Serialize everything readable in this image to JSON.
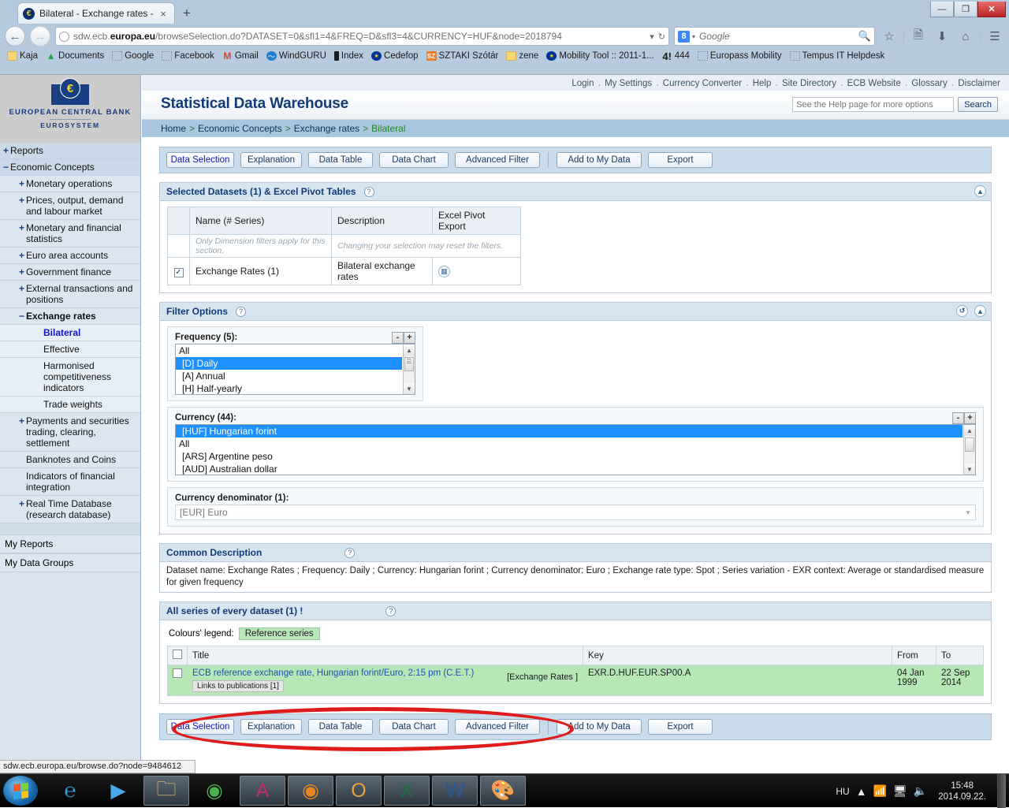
{
  "browser": {
    "tab_title": "Bilateral - Exchange rates - ...",
    "tab_favicon": "euro-icon",
    "new_tab_label": "+",
    "close_tab_label": "×",
    "url_prefix": "sdw.ecb.",
    "url_domain": "europa.eu",
    "url_path": "/browseSelection.do?DATASET=0&sfl1=4&FREQ=D&sfl3=4&CURRENCY=HUF&node=2018794",
    "search_engine": "Google",
    "search_placeholder": "Google",
    "window_minimize": "—",
    "window_restore": "❐",
    "window_close": "✕",
    "bookmarks": [
      {
        "label": "Kaja",
        "icon": "folder-icon"
      },
      {
        "label": "Documents",
        "icon": "drive-icon"
      },
      {
        "label": "Google",
        "icon": "dotted-icon"
      },
      {
        "label": "Facebook",
        "icon": "dotted-icon"
      },
      {
        "label": "Gmail",
        "icon": "gmail-icon"
      },
      {
        "label": "WindGURU",
        "icon": "wind-icon"
      },
      {
        "label": "Index",
        "icon": "index-icon"
      },
      {
        "label": "Cedefop",
        "icon": "eu-icon"
      },
      {
        "label": "SZTAKI Szótár",
        "icon": "sztaki-icon"
      },
      {
        "label": "zene",
        "icon": "folder-icon"
      },
      {
        "label": "Mobility Tool :: 2011-1...",
        "icon": "eu-icon"
      },
      {
        "label": "444",
        "icon": "444-icon"
      },
      {
        "label": "Europass Mobility",
        "icon": "dotted-icon"
      },
      {
        "label": "Tempus IT Helpdesk",
        "icon": "dotted-icon"
      }
    ]
  },
  "sidebar": {
    "logo": {
      "symbol": "€",
      "line1": "EUROPEAN CENTRAL BANK",
      "line2": "EUROSYSTEM"
    },
    "tree": [
      {
        "label": "Reports",
        "level": 0,
        "toggle": "+",
        "selected": false
      },
      {
        "label": "Economic Concepts",
        "level": 0,
        "toggle": "−",
        "selected": false
      },
      {
        "label": "Monetary operations",
        "level": 1,
        "toggle": "+",
        "selected": false
      },
      {
        "label": "Prices, output, demand and labour market",
        "level": 1,
        "toggle": "+",
        "selected": false
      },
      {
        "label": "Monetary and financial statistics",
        "level": 1,
        "toggle": "+",
        "selected": false
      },
      {
        "label": "Euro area accounts",
        "level": 1,
        "toggle": "+",
        "selected": false
      },
      {
        "label": "Government finance",
        "level": 1,
        "toggle": "+",
        "selected": false
      },
      {
        "label": "External transactions and positions",
        "level": 1,
        "toggle": "+",
        "selected": false
      },
      {
        "label": "Exchange rates",
        "level": 1,
        "toggle": "−",
        "selected": false,
        "open": true
      },
      {
        "label": "Bilateral",
        "level": 2,
        "toggle": "",
        "selected": true
      },
      {
        "label": "Effective",
        "level": 2,
        "toggle": "",
        "selected": false
      },
      {
        "label": "Harmonised competitiveness indicators",
        "level": 2,
        "toggle": "",
        "selected": false
      },
      {
        "label": "Trade weights",
        "level": 2,
        "toggle": "",
        "selected": false
      },
      {
        "label": "Payments and securities trading, clearing, settlement",
        "level": 1,
        "toggle": "+",
        "selected": false
      },
      {
        "label": "Banknotes and Coins",
        "level": 1,
        "toggle": "",
        "selected": false
      },
      {
        "label": "Indicators of financial integration",
        "level": 1,
        "toggle": "",
        "selected": false
      },
      {
        "label": "Real Time Database (research database)",
        "level": 1,
        "toggle": "+",
        "selected": false
      }
    ],
    "footer_items": [
      {
        "label": "My Reports"
      },
      {
        "label": "My Data Groups"
      }
    ]
  },
  "header": {
    "top_links": [
      "Login",
      "My Settings",
      "Currency Converter",
      "Help",
      "Site Directory",
      "ECB Website",
      "Glossary",
      "Disclaimer"
    ],
    "title": "Statistical Data Warehouse",
    "search_placeholder": "See the Help page for more options",
    "search_button": "Search",
    "breadcrumb": [
      "Home",
      "Economic Concepts",
      "Exchange rates",
      "Bilateral"
    ]
  },
  "toolbar": {
    "buttons": [
      {
        "label": "Data Selection",
        "active": true
      },
      {
        "label": "Explanation",
        "active": false
      },
      {
        "label": "Data Table",
        "active": false
      },
      {
        "label": "Data Chart",
        "active": false
      },
      {
        "label": "Advanced Filter",
        "active": false
      },
      {
        "label": "Add to My Data",
        "active": false
      },
      {
        "label": "Export",
        "active": false
      }
    ]
  },
  "datasets_panel": {
    "title": "Selected Datasets (1) & Excel Pivot Tables",
    "help": "?",
    "collapse_icon": "chevron-up-icon",
    "columns": [
      "Name (# Series)",
      "Description",
      "Excel Pivot Export"
    ],
    "notes": [
      "Only Dimension filters apply for this section.",
      "Changing your selection may reset the filters."
    ],
    "rows": [
      {
        "checked": true,
        "name": "Exchange Rates   (1)",
        "description": "Bilateral exchange rates",
        "pivot_icon": "grid-icon"
      }
    ]
  },
  "filter_panel": {
    "title": "Filter Options",
    "help": "?",
    "reset_icon": "reset-icon",
    "collapse_icon": "chevron-up-icon",
    "frequency": {
      "label": "Frequency (5):",
      "minus": "-",
      "plus": "+",
      "options": [
        {
          "label": "All",
          "selected": false,
          "indent": false
        },
        {
          "label": "[D] Daily",
          "selected": true,
          "indent": true
        },
        {
          "label": "[A] Annual",
          "selected": false,
          "indent": true
        },
        {
          "label": "[H] Half-yearly",
          "selected": false,
          "indent": true
        }
      ]
    },
    "currency": {
      "label": "Currency  (44):",
      "minus": "-",
      "plus": "+",
      "options": [
        {
          "label": "[HUF] Hungarian forint",
          "selected": true,
          "indent": true
        },
        {
          "label": "All",
          "selected": false,
          "indent": false
        },
        {
          "label": "[ARS] Argentine peso",
          "selected": false,
          "indent": true
        },
        {
          "label": "[AUD] Australian dollar",
          "selected": false,
          "indent": true
        }
      ]
    },
    "denominator": {
      "label": "Currency denominator  (1):",
      "value": "[EUR] Euro"
    }
  },
  "description_panel": {
    "title": "Common Description",
    "help": "?",
    "text": "Dataset name: Exchange Rates ; Frequency: Daily ; Currency: Hungarian forint ; Currency denominator: Euro ; Exchange rate type: Spot ; Series variation - EXR context: Average or standardised measure for given frequency"
  },
  "series_panel": {
    "title": "All series of every dataset (1) !",
    "help": "?",
    "legend_label": "Colours' legend:",
    "legend_chip": "Reference series",
    "columns": [
      "Title",
      "Key",
      "From",
      "To"
    ],
    "rows": [
      {
        "title": "ECB reference exchange rate, Hungarian forint/Euro, 2:15 pm (C.E.T.)",
        "publications": "Links to publications [1]",
        "dataset_tag": "[Exchange Rates ]",
        "key": "EXR.D.HUF.EUR.SP00.A",
        "from": "04 Jan 1999",
        "to": "22 Sep 2014",
        "reference": true
      }
    ]
  },
  "status_bar": {
    "text": "sdw.ecb.europa.eu/browse.do?node=9484612"
  },
  "taskbar": {
    "start_label": "start-button",
    "items": [
      {
        "icon": "internet-explorer-icon",
        "glyph": "℮",
        "color": "#2aa5e0",
        "active": false
      },
      {
        "icon": "media-player-icon",
        "glyph": "▶",
        "color": "#4aa8e8",
        "active": false
      },
      {
        "icon": "explorer-folder-icon",
        "glyph": "🗀",
        "color": "#e8c268",
        "active": true
      },
      {
        "icon": "chrome-icon",
        "glyph": "◉",
        "color": "#4caf50",
        "active": false
      },
      {
        "icon": "access-icon",
        "glyph": "A",
        "color": "#c72a6e",
        "active": true
      },
      {
        "icon": "firefox-icon",
        "glyph": "◉",
        "color": "#e8861f",
        "active": true
      },
      {
        "icon": "outlook-icon",
        "glyph": "O",
        "color": "#e8a33d",
        "active": true
      },
      {
        "icon": "excel-icon",
        "glyph": "X",
        "color": "#1e7145",
        "active": true
      },
      {
        "icon": "word-icon",
        "glyph": "W",
        "color": "#2b579a",
        "active": true
      },
      {
        "icon": "paint-icon",
        "glyph": "🎨",
        "color": "#9ab9d8",
        "active": true
      }
    ],
    "tray": {
      "language": "HU",
      "show_hidden_icon": "chevron-up-icon",
      "network_icon": "network-warning-icon",
      "monitor_icon": "monitor-icon",
      "volume_icon": "volume-muted-icon",
      "time": "15:48",
      "date": "2014.09.22."
    }
  },
  "annotation": {
    "shape": "red-ellipse",
    "color": "#e01b1b"
  }
}
